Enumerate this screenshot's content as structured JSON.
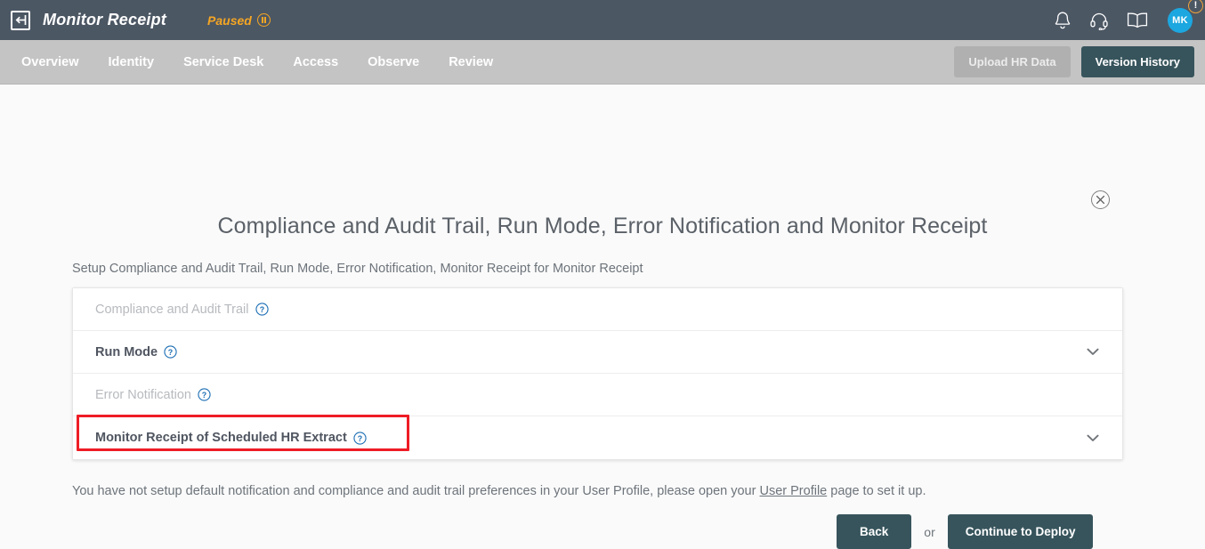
{
  "header": {
    "logo_icon": "back-arrow-box-icon",
    "app_title": "Monitor Receipt",
    "status_label": "Paused",
    "status_icon": "pause-circle-icon",
    "status_color": "#f5a623",
    "icons": [
      {
        "name": "notifications-bell-icon",
        "label": "Notifications"
      },
      {
        "name": "support-headset-icon",
        "label": "Support"
      },
      {
        "name": "documentation-book-icon",
        "label": "Documentation"
      }
    ],
    "avatar": {
      "initials": "MK",
      "color": "#1ca7e0"
    },
    "alert_badge": "!"
  },
  "nav": {
    "items": [
      {
        "label": "Overview",
        "name": "overview"
      },
      {
        "label": "Identity",
        "name": "identity"
      },
      {
        "label": "Service Desk",
        "name": "service-desk"
      },
      {
        "label": "Access",
        "name": "access"
      },
      {
        "label": "Observe",
        "name": "observe"
      },
      {
        "label": "Review",
        "name": "review"
      }
    ],
    "actions": {
      "upload_label": "Upload HR Data",
      "version_label": "Version History"
    },
    "background": "#c4c4c4"
  },
  "main": {
    "close_icon": "close-circle-icon",
    "title": "Compliance and Audit Trail, Run Mode, Error Notification and Monitor Receipt",
    "subtitle": "Setup Compliance and Audit Trail, Run Mode, Error Notification, Monitor Receipt for Monitor Receipt",
    "accordion": [
      {
        "label": "Compliance and Audit Trail",
        "name": "compliance-and-audit-trail",
        "enabled": false,
        "expandable": false,
        "help": "help-circle-icon"
      },
      {
        "label": "Run Mode",
        "name": "run-mode",
        "enabled": true,
        "expandable": true,
        "help": "help-circle-icon",
        "chevron": "chevron-down-icon"
      },
      {
        "label": "Error Notification",
        "name": "error-notification",
        "enabled": false,
        "expandable": false,
        "help": "help-circle-icon"
      },
      {
        "label": "Monitor Receipt of Scheduled HR Extract",
        "name": "monitor-receipt-of-scheduled-hr-extract",
        "enabled": true,
        "expandable": true,
        "help": "help-circle-icon",
        "chevron": "chevron-down-icon",
        "highlighted": true
      }
    ],
    "highlight_color": "#ee1c25",
    "footer_note": {
      "before": "You have not setup default notification and compliance and audit trail preferences in your User Profile, please open your ",
      "link": "User Profile",
      "after": " page to set it up."
    },
    "buttons": {
      "back_label": "Back",
      "or_label": "or",
      "continue_label": "Continue to Deploy"
    }
  }
}
